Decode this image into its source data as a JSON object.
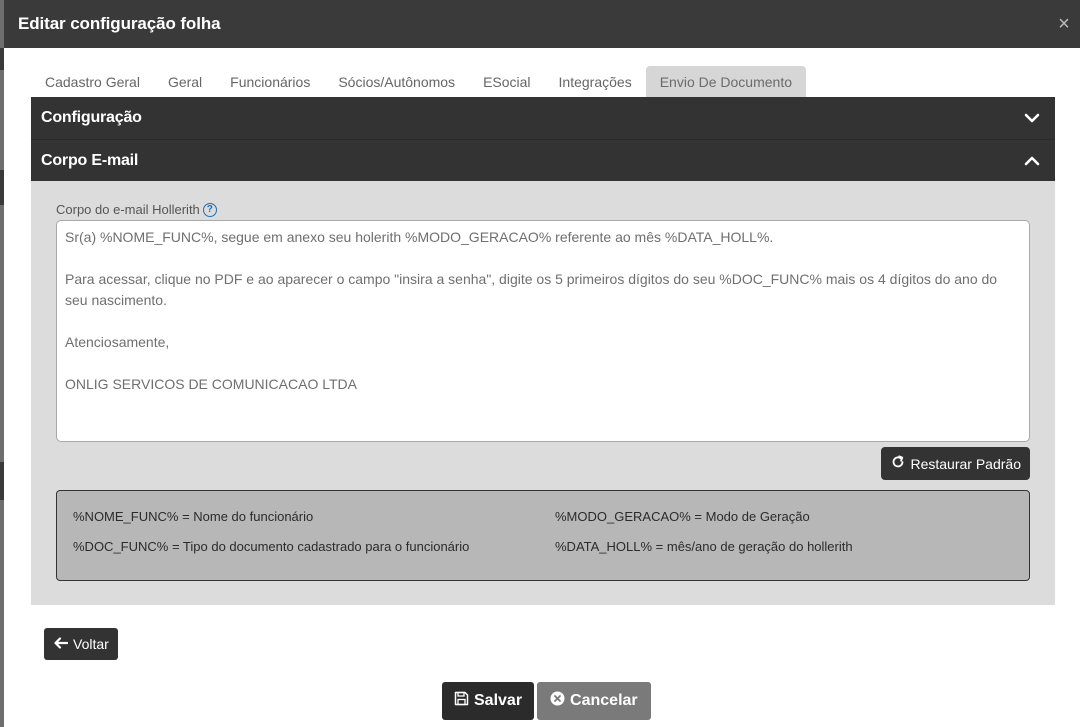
{
  "modal": {
    "title": "Editar configuração folha",
    "close_label": "×"
  },
  "tabs": [
    {
      "label": "Cadastro Geral",
      "active": false
    },
    {
      "label": "Geral",
      "active": false
    },
    {
      "label": "Funcionários",
      "active": false
    },
    {
      "label": "Sócios/Autônomos",
      "active": false
    },
    {
      "label": "ESocial",
      "active": false
    },
    {
      "label": "Integrações",
      "active": false
    },
    {
      "label": "Envio De Documento",
      "active": true
    }
  ],
  "accordion": {
    "configuracao": {
      "title": "Configuração",
      "expanded": false
    },
    "corpo_email": {
      "title": "Corpo E-mail",
      "expanded": true
    }
  },
  "email": {
    "field_label": "Corpo do e-mail Hollerith",
    "help_icon": "?",
    "lines": [
      "Sr(a) %NOME_FUNC%, segue em anexo seu holerith %MODO_GERACAO% referente ao mês %DATA_HOLL%.",
      "",
      "Para acessar, clique no PDF e ao aparecer o campo \"insira a senha\", digite os 5 primeiros dígitos do seu %DOC_FUNC% mais os 4 dígitos do ano do seu nascimento.",
      "",
      "Atenciosamente,",
      "",
      "ONLIG SERVICOS DE COMUNICACAO LTDA"
    ],
    "restore_label": "Restaurar Padrão"
  },
  "legend": [
    "%NOME_FUNC% = Nome do funcionário",
    "%MODO_GERACAO% = Modo de Geração",
    "%DOC_FUNC% = Tipo do documento cadastrado para o funcionário",
    "%DATA_HOLL% = mês/ano de geração do hollerith"
  ],
  "actions": {
    "back_label": "Voltar",
    "save_label": "Salvar",
    "cancel_label": "Cancelar"
  },
  "colors": {
    "header_bg": "#3a3a3a",
    "accordion_bg": "#333333",
    "panel_bg": "#dcdcdc",
    "legend_bg": "#b7b7b7",
    "cancel_bg": "#7a7a7a",
    "help_icon": "#1f6fb2"
  },
  "icons": {
    "close": "close-icon",
    "chevron_down": "chevron-down-icon",
    "chevron_up": "chevron-up-icon",
    "help": "question-circle-icon",
    "restore": "refresh-icon",
    "back": "arrow-left-icon",
    "save": "floppy-disk-icon",
    "cancel": "x-circle-icon"
  }
}
